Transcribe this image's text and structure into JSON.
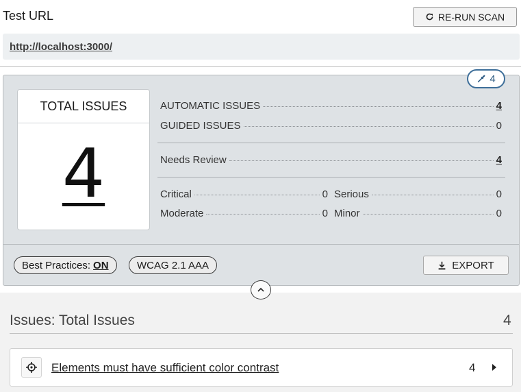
{
  "header": {
    "title": "Test URL",
    "rerun_label": "RE-RUN SCAN"
  },
  "url_bar": {
    "url": "http://localhost:3000/"
  },
  "summary": {
    "tool_badge_count": "4",
    "total_card": {
      "title": "TOTAL ISSUES",
      "count": "4"
    },
    "automatic": {
      "label": "AUTOMATIC ISSUES",
      "value": "4"
    },
    "guided": {
      "label": "GUIDED ISSUES",
      "value": "0"
    },
    "needs_review": {
      "label": "Needs Review",
      "value": "4"
    },
    "impact": {
      "critical": {
        "label": "Critical",
        "value": "0"
      },
      "serious": {
        "label": "Serious",
        "value": "0"
      },
      "moderate": {
        "label": "Moderate",
        "value": "0"
      },
      "minor": {
        "label": "Minor",
        "value": "0"
      }
    },
    "best_practices": {
      "label": "Best Practices:",
      "state": "ON"
    },
    "standard": "WCAG 2.1 AAA",
    "export_label": "EXPORT"
  },
  "issues": {
    "heading": "Issues: Total Issues",
    "count": "4",
    "items": [
      {
        "title": "Elements must have sufficient color contrast",
        "count": "4"
      }
    ]
  },
  "icons": {
    "rerun": "refresh-icon",
    "badge": "eyedropper-icon",
    "export": "download-icon",
    "collapse": "chevron-up-icon",
    "highlight": "crosshair-icon",
    "row": "caret-right-icon"
  },
  "colors": {
    "panel_bg": "#dee2e5",
    "badge_accent": "#3d6e99",
    "url_bar_bg": "#edf0f2"
  }
}
